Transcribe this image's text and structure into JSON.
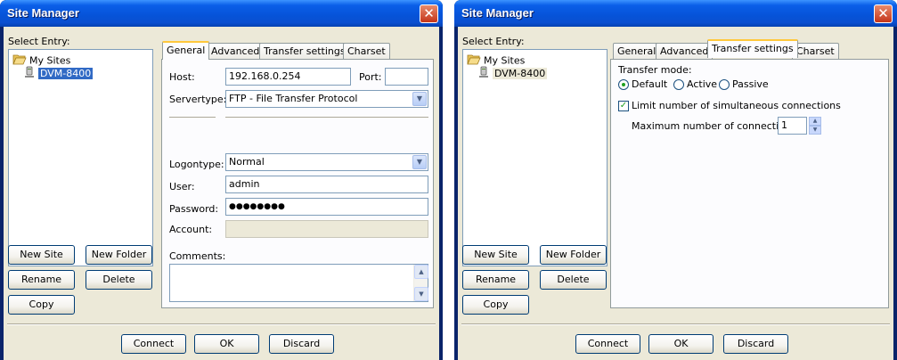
{
  "left": {
    "title": "Site Manager",
    "select_entry": "Select Entry:",
    "tree": {
      "root": "My Sites",
      "child": "DVM-8400"
    },
    "tabs": [
      "General",
      "Advanced",
      "Transfer settings",
      "Charset"
    ],
    "general": {
      "host_label": "Host:",
      "host_value": "192.168.0.254",
      "port_label": "Port:",
      "port_value": "",
      "servertype_label": "Servertype:",
      "servertype_value": "FTP - File Transfer Protocol",
      "logontype_label": "Logontype:",
      "logontype_value": "Normal",
      "user_label": "User:",
      "user_value": "admin",
      "password_label": "Password:",
      "password_value": "●●●●●●●●",
      "account_label": "Account:",
      "comments_label": "Comments:"
    },
    "buttons": {
      "new_site": "New Site",
      "new_folder": "New Folder",
      "rename": "Rename",
      "delete": "Delete",
      "copy": "Copy",
      "connect": "Connect",
      "ok": "OK",
      "discard": "Discard"
    }
  },
  "right": {
    "title": "Site Manager",
    "select_entry": "Select Entry:",
    "tree": {
      "root": "My Sites",
      "child": "DVM-8400"
    },
    "tabs": [
      "General",
      "Advanced",
      "Transfer settings",
      "Charset"
    ],
    "transfer": {
      "mode_label": "Transfer mode:",
      "default": "Default",
      "active": "Active",
      "passive": "Passive",
      "selected_mode": "Default",
      "limit_label": "Limit number of simultaneous connections",
      "limit_checked": true,
      "max_label": "Maximum number of connections:",
      "max_value": "1"
    },
    "buttons": {
      "new_site": "New Site",
      "new_folder": "New Folder",
      "rename": "Rename",
      "delete": "Delete",
      "copy": "Copy",
      "connect": "Connect",
      "ok": "OK",
      "discard": "Discard"
    }
  },
  "colors": {
    "titlebar": "#0a5fe8",
    "selection": "#316ac5",
    "dialog_bg": "#ece9d8",
    "active_tab_accent": "#ffc83c"
  },
  "icons": {
    "folder": "open-folder-icon",
    "site": "computer-icon",
    "close": "close-icon"
  }
}
